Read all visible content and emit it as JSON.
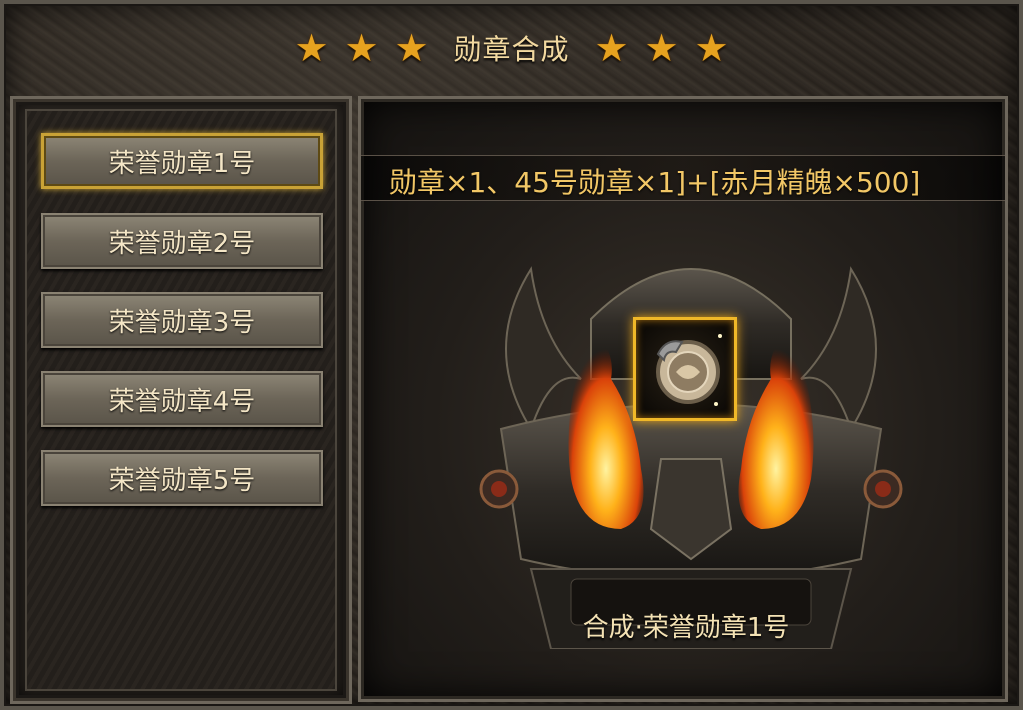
{
  "window": {
    "title": "勋章合成",
    "accent": "#e6a21f"
  },
  "stars_left": [
    "★",
    "★",
    "★"
  ],
  "stars_right": [
    "★",
    "★",
    "★"
  ],
  "medal_list": {
    "items": [
      {
        "label": "荣誉勋章1号",
        "selected": true
      },
      {
        "label": "荣誉勋章2号",
        "selected": false
      },
      {
        "label": "荣誉勋章3号",
        "selected": false
      },
      {
        "label": "荣誉勋章4号",
        "selected": false
      },
      {
        "label": "荣誉勋章5号",
        "selected": false
      }
    ]
  },
  "synthesis": {
    "recipe_text": "勋章×1、45号勋章×1]+[赤月精魄×500]",
    "result_label": "合成·荣誉勋章1号",
    "slot_icon": "medal-icon"
  }
}
